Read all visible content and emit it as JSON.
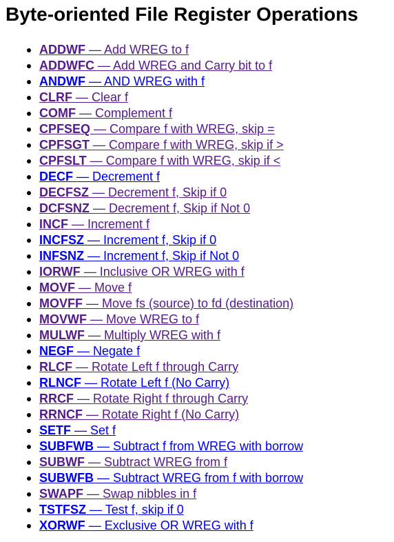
{
  "page": {
    "title": "Byte-oriented File Register Operations"
  },
  "colors": {
    "visited_link": "#551a8b",
    "unvisited_link": "#0000ee",
    "text": "#000000",
    "background": "#ffffff"
  },
  "instructions": [
    {
      "mnemonic": "ADDWF",
      "description": "— Add WREG to f",
      "visited": true
    },
    {
      "mnemonic": "ADDWFC",
      "description": "— Add WREG and Carry bit to f",
      "visited": true
    },
    {
      "mnemonic": "ANDWF",
      "description": "— AND WREG with f",
      "visited": false
    },
    {
      "mnemonic": "CLRF",
      "description": "— Clear f",
      "visited": true
    },
    {
      "mnemonic": "COMF",
      "description": "— Complement f",
      "visited": true
    },
    {
      "mnemonic": "CPFSEQ",
      "description": "— Compare f with WREG, skip =",
      "visited": true
    },
    {
      "mnemonic": "CPFSGT",
      "description": "— Compare f with WREG, skip if >",
      "visited": true
    },
    {
      "mnemonic": "CPFSLT",
      "description": "— Compare f with WREG, skip if <",
      "visited": true
    },
    {
      "mnemonic": "DECF",
      "description": "— Decrement f",
      "visited": false
    },
    {
      "mnemonic": "DECFSZ",
      "description": "— Decrement f, Skip if 0",
      "visited": true
    },
    {
      "mnemonic": "DCFSNZ",
      "description": "— Decrement f, Skip if Not 0",
      "visited": true
    },
    {
      "mnemonic": "INCF",
      "description": "— Increment f",
      "visited": true
    },
    {
      "mnemonic": "INCFSZ",
      "description": "— Increment f, Skip if 0",
      "visited": false
    },
    {
      "mnemonic": "INFSNZ",
      "description": "— Increment f, Skip if Not 0",
      "visited": false
    },
    {
      "mnemonic": "IORWF",
      "description": "— Inclusive OR WREG with f",
      "visited": true
    },
    {
      "mnemonic": "MOVF",
      "description": "— Move f",
      "visited": true
    },
    {
      "mnemonic": "MOVFF",
      "description": "— Move fs (source) to fd (destination)",
      "visited": true
    },
    {
      "mnemonic": "MOVWF",
      "description": "— Move WREG to f",
      "visited": true
    },
    {
      "mnemonic": "MULWF",
      "description": "— Multiply WREG with f",
      "visited": true
    },
    {
      "mnemonic": "NEGF",
      "description": "— Negate f",
      "visited": false
    },
    {
      "mnemonic": "RLCF",
      "description": "— Rotate Left f through Carry",
      "visited": true
    },
    {
      "mnemonic": "RLNCF",
      "description": "— Rotate Left f (No Carry)",
      "visited": false
    },
    {
      "mnemonic": "RRCF",
      "description": "— Rotate Right f through Carry",
      "visited": true
    },
    {
      "mnemonic": "RRNCF",
      "description": "— Rotate Right f (No Carry)",
      "visited": true
    },
    {
      "mnemonic": "SETF",
      "description": "— Set f",
      "visited": false
    },
    {
      "mnemonic": "SUBFWB",
      "description": "— Subtract f from WREG with borrow",
      "visited": false
    },
    {
      "mnemonic": "SUBWF",
      "description": "— Subtract WREG from f",
      "visited": true
    },
    {
      "mnemonic": "SUBWFB",
      "description": "— Subtract WREG from f with borrow",
      "visited": false
    },
    {
      "mnemonic": "SWAPF",
      "description": "— Swap nibbles in f",
      "visited": true
    },
    {
      "mnemonic": "TSTFSZ",
      "description": "— Test f, skip if 0",
      "visited": false
    },
    {
      "mnemonic": "XORWF",
      "description": "— Exclusive OR WREG with f",
      "visited": false
    }
  ]
}
